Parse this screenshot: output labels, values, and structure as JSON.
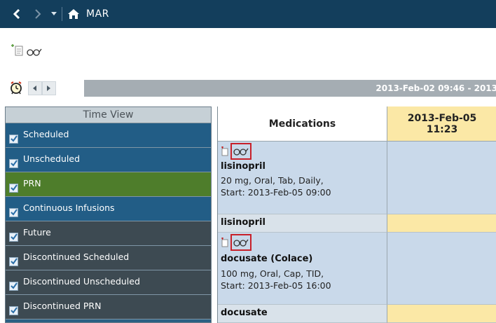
{
  "window": {
    "title": "MAR"
  },
  "toolbar": {
    "icons": [
      "add-document-icon",
      "glasses-icon"
    ]
  },
  "date_range": {
    "text": "2013-Feb-02 09:46 - 2013"
  },
  "filter_panel": {
    "header": "Time View",
    "items": [
      {
        "label": "Scheduled",
        "checked": true,
        "color": "#225d86"
      },
      {
        "label": "Unscheduled",
        "checked": true,
        "color": "#225d86"
      },
      {
        "label": "PRN",
        "checked": true,
        "color": "#4e7d2b"
      },
      {
        "label": "Continuous Infusions",
        "checked": true,
        "color": "#225d86"
      },
      {
        "label": "Future",
        "checked": true,
        "color": "#3d4a52"
      },
      {
        "label": "Discontinued Scheduled",
        "checked": true,
        "color": "#3d4a52"
      },
      {
        "label": "Discontinued Unscheduled",
        "checked": true,
        "color": "#3d4a52"
      },
      {
        "label": "Discontinued PRN",
        "checked": true,
        "color": "#3d4a52"
      }
    ]
  },
  "table": {
    "col_medications": "Medications",
    "col_date_line1": "2013-Feb-05",
    "col_date_line2": "11:23",
    "rows": [
      {
        "name": "lisinopril",
        "detail1": "20 mg, Oral, Tab, Daily,",
        "detail2": "Start: 2013-Feb-05 09:00"
      },
      {
        "name": "lisinopril"
      },
      {
        "name": "docusate (Colace)",
        "detail1": "100 mg, Oral, Cap, TID,",
        "detail2": "Start: 2013-Feb-05 16:00"
      },
      {
        "name": "docusate"
      }
    ]
  }
}
